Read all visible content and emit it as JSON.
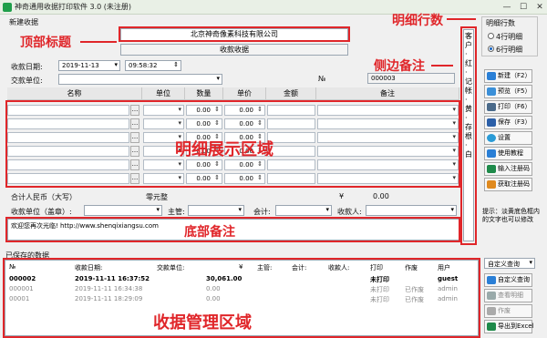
{
  "window": {
    "title": "神奇通用收据打印软件 3.0 (未注册)"
  },
  "header": {
    "section_label": "新建收据",
    "company": "北京神奇像素科技有限公司",
    "doc_title": "收款收据"
  },
  "fields": {
    "date_label": "收款日期:",
    "date_value": "2019-11-13",
    "time_value": "09:58:32",
    "payer_label": "交款单位:",
    "no_label": "№",
    "no_value": "000003"
  },
  "columns": [
    "名称",
    "单位",
    "数量",
    "单价",
    "金额",
    "备注"
  ],
  "rows": [
    {
      "qty": "0.00",
      "price": "0.00"
    },
    {
      "qty": "0.00",
      "price": "0.00"
    },
    {
      "qty": "0.00",
      "price": "0.00"
    },
    {
      "qty": "0.00",
      "price": "0.00"
    },
    {
      "qty": "0.00",
      "price": "0.00"
    },
    {
      "qty": "0.00",
      "price": "0.00"
    }
  ],
  "totals": {
    "label": "合计人民币（大写）",
    "caps": "零元整",
    "yen": "¥",
    "amount": "0.00"
  },
  "footer": {
    "unit_label": "收款单位（盖章）:",
    "supervisor": "主管:",
    "accountant": "会计:",
    "receiver": "收款人:",
    "note": "欢迎您再次光临! http://www.shenqixiangsu.com"
  },
  "side_note": "客户·红·记帐·黄·存根·白",
  "right_panel": {
    "group_label": "明细行数",
    "opt4": "4行明细",
    "opt6": "6行明细",
    "buttons": [
      "新建（F2）",
      "预览（F5）",
      "打印（F6）",
      "保存（F3）",
      "设置",
      "使用教程",
      "输入注册码",
      "获取注册码"
    ],
    "hint": "提示：淡黄底色框内的文字也可以修改"
  },
  "saved": {
    "label": "已保存的数据",
    "headers": [
      "№",
      "收款日期:",
      "交款单位:",
      "¥",
      "主管:",
      "会计:",
      "收款人:",
      "打印",
      "作废",
      "用户"
    ],
    "records": [
      {
        "no": "000002",
        "date": "2019-11-11 16:37:52",
        "amount": "30,061.00",
        "print": "未打印",
        "void": "",
        "user": "guest"
      },
      {
        "no": "000001",
        "date": "2019-11-11 16:34:38",
        "amount": "0.00",
        "print": "未打印",
        "void": "已作废",
        "user": "admin"
      },
      {
        "no": "00001",
        "date": "2019-11-11 18:29:09",
        "amount": "0.00",
        "print": "未打印",
        "void": "已作废",
        "user": "admin"
      }
    ],
    "query_select": "自定义查询",
    "buttons": [
      "自定义查询",
      "查看明细",
      "作废",
      "导出到Excel"
    ]
  },
  "annotations": {
    "header": "顶部标题",
    "rows_count": "明细行数",
    "side": "侧边备注",
    "detail": "明细展示区域",
    "bottom": "底部备注",
    "manage": "收据管理区域"
  },
  "colors": {
    "annotation": "#e0262a",
    "accent": "#1f9e4a"
  }
}
